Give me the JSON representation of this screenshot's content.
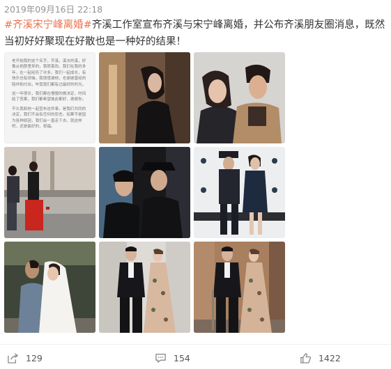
{
  "post": {
    "timestamp": "2019年09月16日 22:18",
    "hashtag": "#齐溪宋宁峰离婚#",
    "text": "齐溪工作室宣布齐溪与宋宁峰离婚，并公布齐溪朋友圈消息，既然当初好好聚现在好散也是一种好的结果！"
  },
  "photos": {
    "note_paragraph_1": "老开始我的这个名字，齐溪，溪水的溪，好像从他那里来的，我很喜欢。我们在我的多年，在一起经历了许多，我们一起成长，有快乐也有烦恼，我很感谢他，也谢谢曾经的陪伴和付出，毕竟我们都有过最好的时光。",
    "note_paragraph_2": "这一年很长，我们都在慢慢的做决定，时间给了答案，我们都希望彼此都好，谢谢你。",
    "note_paragraph_3": "不久我和他一起宣布这件事，是我们共同的决定，我们不会有任何的怨言。如果不是因为各种原因，我们会一直走下去。就这样吧，还是最好的，祝福。"
  },
  "actions": {
    "forward_count": "129",
    "comment_count": "154",
    "like_count": "1422"
  }
}
